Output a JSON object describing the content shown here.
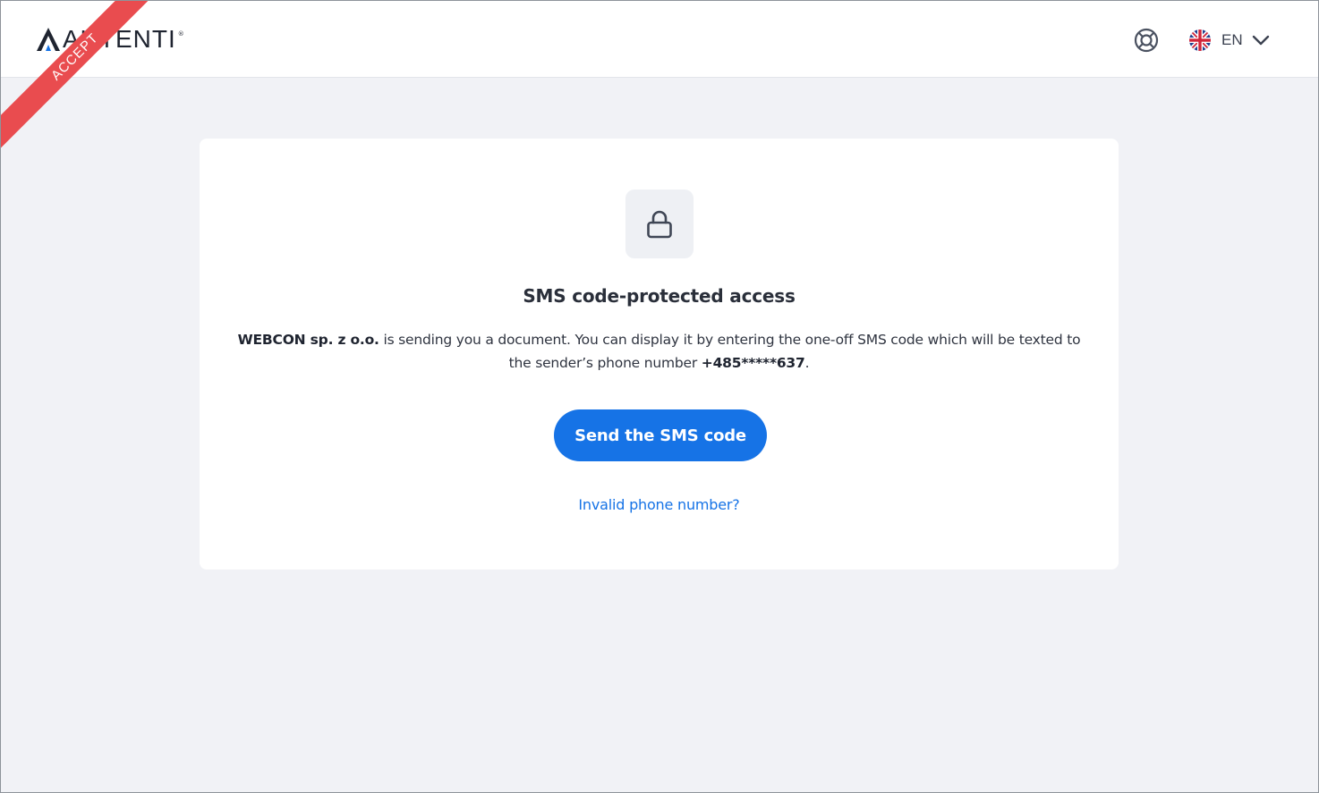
{
  "header": {
    "logo_text": "AUTENTI",
    "environment_ribbon": "ACCEPT",
    "language": {
      "code": "EN",
      "flag_icon": "uk-flag-icon",
      "chevron_icon": "chevron-down-icon"
    },
    "help_icon": "lifebuoy-icon"
  },
  "card": {
    "icon": "lock-icon",
    "title": "SMS code-protected access",
    "description": {
      "sender": "WEBCON sp. z o.o.",
      "text_1": " is sending you a document. You can display it by entering the one-off SMS code which will be texted to the sender’s phone number ",
      "phone": "+485*****637",
      "text_2": "."
    },
    "send_button_label": "Send the SMS code",
    "invalid_phone_link": "Invalid phone number?"
  },
  "colors": {
    "page_background": "#f1f2f6",
    "accent": "#1673e6",
    "ribbon": "#e94c4f",
    "logo_accent": "#1673e6"
  }
}
